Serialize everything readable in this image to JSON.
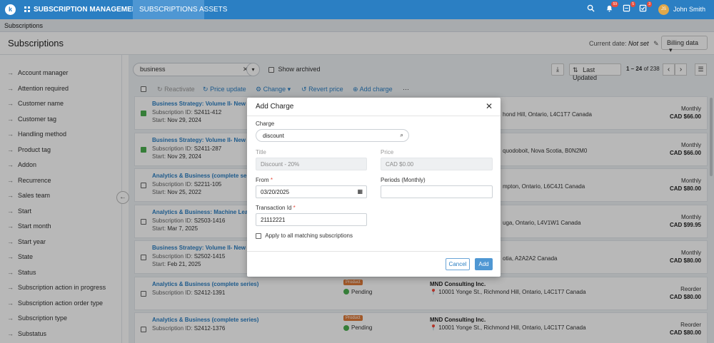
{
  "topbar": {
    "app_name": "SUBSCRIPTION MANAGEMENT",
    "nav": [
      "SUBSCRIPTIONS",
      "ASSETS"
    ],
    "notif_badges": [
      "59",
      "5",
      "3"
    ],
    "avatar_initials": "JS",
    "user": "John Smith"
  },
  "breadcrumb": "Subscriptions",
  "header": {
    "title": "Subscriptions",
    "current_date_label": "Current date:",
    "current_date_value": "Not set",
    "billing_button": "Billing data"
  },
  "sidebar": {
    "items": [
      "Account manager",
      "Attention required",
      "Customer name",
      "Customer tag",
      "Handling method",
      "Product tag",
      "Addon",
      "Recurrence",
      "Sales team",
      "Start",
      "Start month",
      "Start year",
      "State",
      "Status",
      "Subscription action in progress",
      "Subscription action order type",
      "Subscription type",
      "Substatus"
    ]
  },
  "search": {
    "value": "business"
  },
  "show_archived": "Show archived",
  "sort": {
    "label": "Last Updated",
    "range": "1 – 24",
    "of": "of",
    "total": "238"
  },
  "toolbar": {
    "reactivate": "Reactivate",
    "price_update": "Price update",
    "change": "Change",
    "revert_price": "Revert price",
    "add_charge": "Add charge",
    "more": "···"
  },
  "rows": [
    {
      "title": "Business Strategy: Volume II- New",
      "id_label": "Subscription ID:",
      "id": "S2411-412",
      "start_label": "Start:",
      "start": "Nov 29, 2024",
      "address": "hond Hill, Ontario, L4C1T7 Canada",
      "freq": "Monthly",
      "price": "CAD $66.00",
      "checked": true
    },
    {
      "title": "Business Strategy: Volume II- New",
      "id_label": "Subscription ID:",
      "id": "S2411-287",
      "start_label": "Start:",
      "start": "Nov 29, 2024",
      "address": "quodoboit, Nova Scotia, B0N2M0",
      "freq": "Monthly",
      "price": "CAD $66.00",
      "checked": true
    },
    {
      "title": "Analytics & Business (complete seri",
      "id_label": "Subscription ID:",
      "id": "S2211-105",
      "start_label": "Start:",
      "start": "Nov 25, 2022",
      "address": "mpton, Ontario, L6C4J1 Canada",
      "freq": "Monthly",
      "price": "CAD $80.00",
      "checked": false
    },
    {
      "title": "Analytics & Business: Machine Lear",
      "id_label": "Subscription ID:",
      "id": "S2503-1416",
      "start_label": "Start:",
      "start": "Mar 7, 2025",
      "address": "uga, Ontario, L4V1W1 Canada",
      "freq": "Monthly",
      "price": "CAD $99.95",
      "checked": false
    },
    {
      "title": "Business Strategy: Volume II- New",
      "id_label": "Subscription ID:",
      "id": "S2502-1415",
      "start_label": "Start:",
      "start": "Feb 21, 2025",
      "address": "otia, A2A2A2 Canada",
      "freq": "Monthly",
      "price": "CAD $80.00",
      "checked": false
    },
    {
      "title": "Analytics & Business (complete series)",
      "id_label": "Subscription ID:",
      "id": "S2412-1391",
      "product": "Product",
      "status": "Pending",
      "company": "MND Consulting Inc.",
      "address": "10001 Yonge St., Richmond Hill, Ontario, L4C1T7 Canada",
      "freq": "Reorder",
      "price": "CAD $80.00",
      "checked": false
    },
    {
      "title": "Analytics & Business (complete series)",
      "id_label": "Subscription ID:",
      "id": "S2412-1376",
      "product": "Product",
      "status": "Pending",
      "company": "MND Consulting Inc.",
      "address": "10001 Yonge St., Richmond Hill, Ontario, L4C1T7 Canada",
      "freq": "Reorder",
      "price": "CAD $80.00",
      "checked": false
    }
  ],
  "modal": {
    "title": "Add Charge",
    "charge_label": "Charge",
    "charge_value": "discount",
    "title_label": "Title",
    "title_value": "Discount - 20%",
    "price_label": "Price",
    "price_value": "CAD $0.00",
    "from_label": "From",
    "from_value": "03/20/2025",
    "periods_label": "Periods (Monthly)",
    "periods_value": "",
    "txn_label": "Transaction Id",
    "txn_value": "21112221",
    "apply_label": "Apply to all matching subscriptions",
    "cancel": "Cancel",
    "add": "Add"
  }
}
